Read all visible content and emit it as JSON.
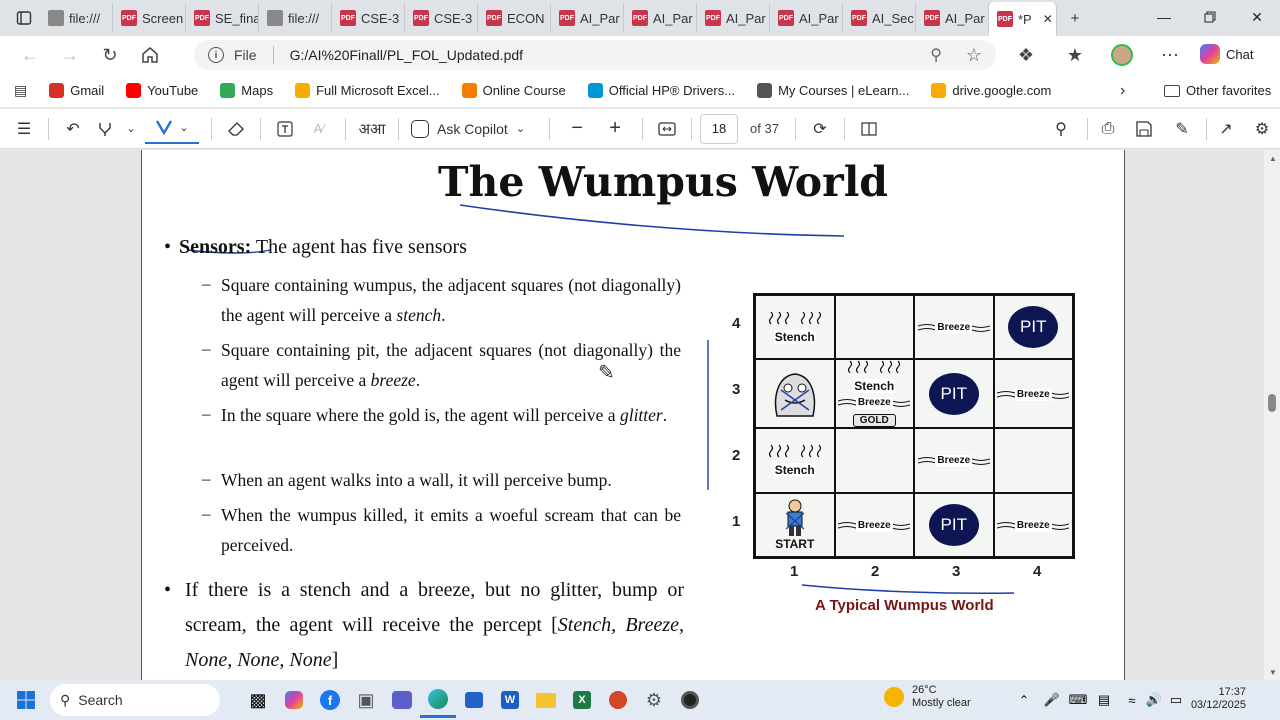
{
  "tabs": [
    {
      "label": "",
      "type": "sidebar"
    },
    {
      "label": "file:///",
      "type": "file"
    },
    {
      "label": "Screen",
      "type": "pdf"
    },
    {
      "label": "SE_fina",
      "type": "pdf"
    },
    {
      "label": "file:///",
      "type": "file"
    },
    {
      "label": "CSE-3",
      "type": "pdf"
    },
    {
      "label": "CSE-3",
      "type": "pdf"
    },
    {
      "label": "ECON",
      "type": "pdf"
    },
    {
      "label": "AI_Par",
      "type": "pdf"
    },
    {
      "label": "AI_Par",
      "type": "pdf"
    },
    {
      "label": "AI_Par",
      "type": "pdf"
    },
    {
      "label": "AI_Par",
      "type": "pdf"
    },
    {
      "label": "AI_Sec",
      "type": "pdf"
    },
    {
      "label": "AI_Par",
      "type": "pdf"
    },
    {
      "label": "*P",
      "type": "pdf",
      "active": true
    }
  ],
  "address": {
    "scheme_label": "File",
    "url": "G:/AI%20Finall/PL_FOL_Updated.pdf",
    "chat_label": "Chat"
  },
  "favorites": [
    {
      "label": "Gmail",
      "icon": "gmail-icon"
    },
    {
      "label": "YouTube",
      "icon": "youtube-icon"
    },
    {
      "label": "Maps",
      "icon": "maps-icon"
    },
    {
      "label": "Full Microsoft Excel...",
      "icon": "drive-icon"
    },
    {
      "label": "Online Course",
      "icon": "blogger-icon"
    },
    {
      "label": "Official HP® Drivers...",
      "icon": "hp-icon"
    },
    {
      "label": "My Courses | eLearn...",
      "icon": "globe-icon"
    },
    {
      "label": "drive.google.com",
      "icon": "drive-icon"
    }
  ],
  "other_favorites": "Other favorites",
  "pdf_toolbar": {
    "copilot_label": "Ask Copilot",
    "page_current": "18",
    "page_total": "of 37",
    "text_icon_label": "अआ"
  },
  "slide": {
    "title": "The Wumpus World",
    "sensors_label": "Sensors:",
    "sensors_text": " The agent has five sensors",
    "sub_bullets": [
      {
        "text": "Square containing wumpus, the adjacent squares (not diagonally) the agent will perceive a ",
        "italic": "stench",
        "tail": "."
      },
      {
        "text": "Square containing pit, the adjacent squares (not diagonally) the agent will perceive a ",
        "italic": "breeze",
        "tail": "."
      },
      {
        "text": "In the square where the gold is, the agent will perceive a ",
        "italic": "glitter",
        "tail": "."
      },
      {
        "text": "When an agent walks into a wall, it will perceive bump.",
        "italic": "",
        "tail": ""
      },
      {
        "text": "When the wumpus killed, it emits a woeful scream that can be perceived.",
        "italic": "",
        "tail": ""
      }
    ],
    "bullet2_text": "If there is a stench and a breeze, but no glitter, bump or scream, the agent will receive the percept [",
    "bullet2_italic": "Stench, Breeze, None, None, None",
    "bullet2_tail": "]",
    "world": {
      "row_labels": [
        "4",
        "3",
        "2",
        "1"
      ],
      "col_labels": [
        "1",
        "2",
        "3",
        "4"
      ],
      "cells": [
        [
          {
            "stench": "Stench"
          },
          {},
          {
            "breeze": "Breeze"
          },
          {
            "pit": "PIT"
          }
        ],
        [
          {
            "wumpus": true
          },
          {
            "stench": "Stench",
            "breeze": "Breeze",
            "gold": "GOLD"
          },
          {
            "pit": "PIT"
          },
          {
            "breeze": "Breeze"
          }
        ],
        [
          {
            "stench": "Stench"
          },
          {},
          {
            "breeze": "Breeze"
          },
          {}
        ],
        [
          {
            "agent": true,
            "start": "START"
          },
          {
            "breeze": "Breeze"
          },
          {
            "pit": "PIT"
          },
          {
            "breeze": "Breeze"
          }
        ]
      ],
      "caption": "A Typical Wumpus World"
    }
  },
  "taskbar": {
    "search_label": "Search",
    "weather_temp": "26°C",
    "weather_desc": "Mostly clear",
    "time": "17:37",
    "date": "03/12/2025"
  }
}
